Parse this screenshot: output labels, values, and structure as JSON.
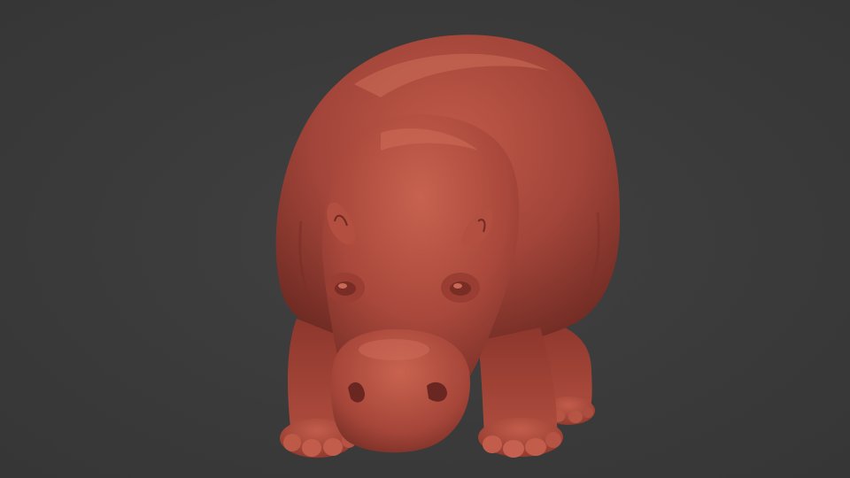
{
  "scene": {
    "subject": "hippopotamus-sculpt",
    "colors": {
      "background": "#3b3b3b",
      "clay_base": "#a8493d",
      "clay_light": "#c4604f",
      "clay_shadow": "#6e2a22",
      "clay_deep": "#4e1c17"
    }
  }
}
